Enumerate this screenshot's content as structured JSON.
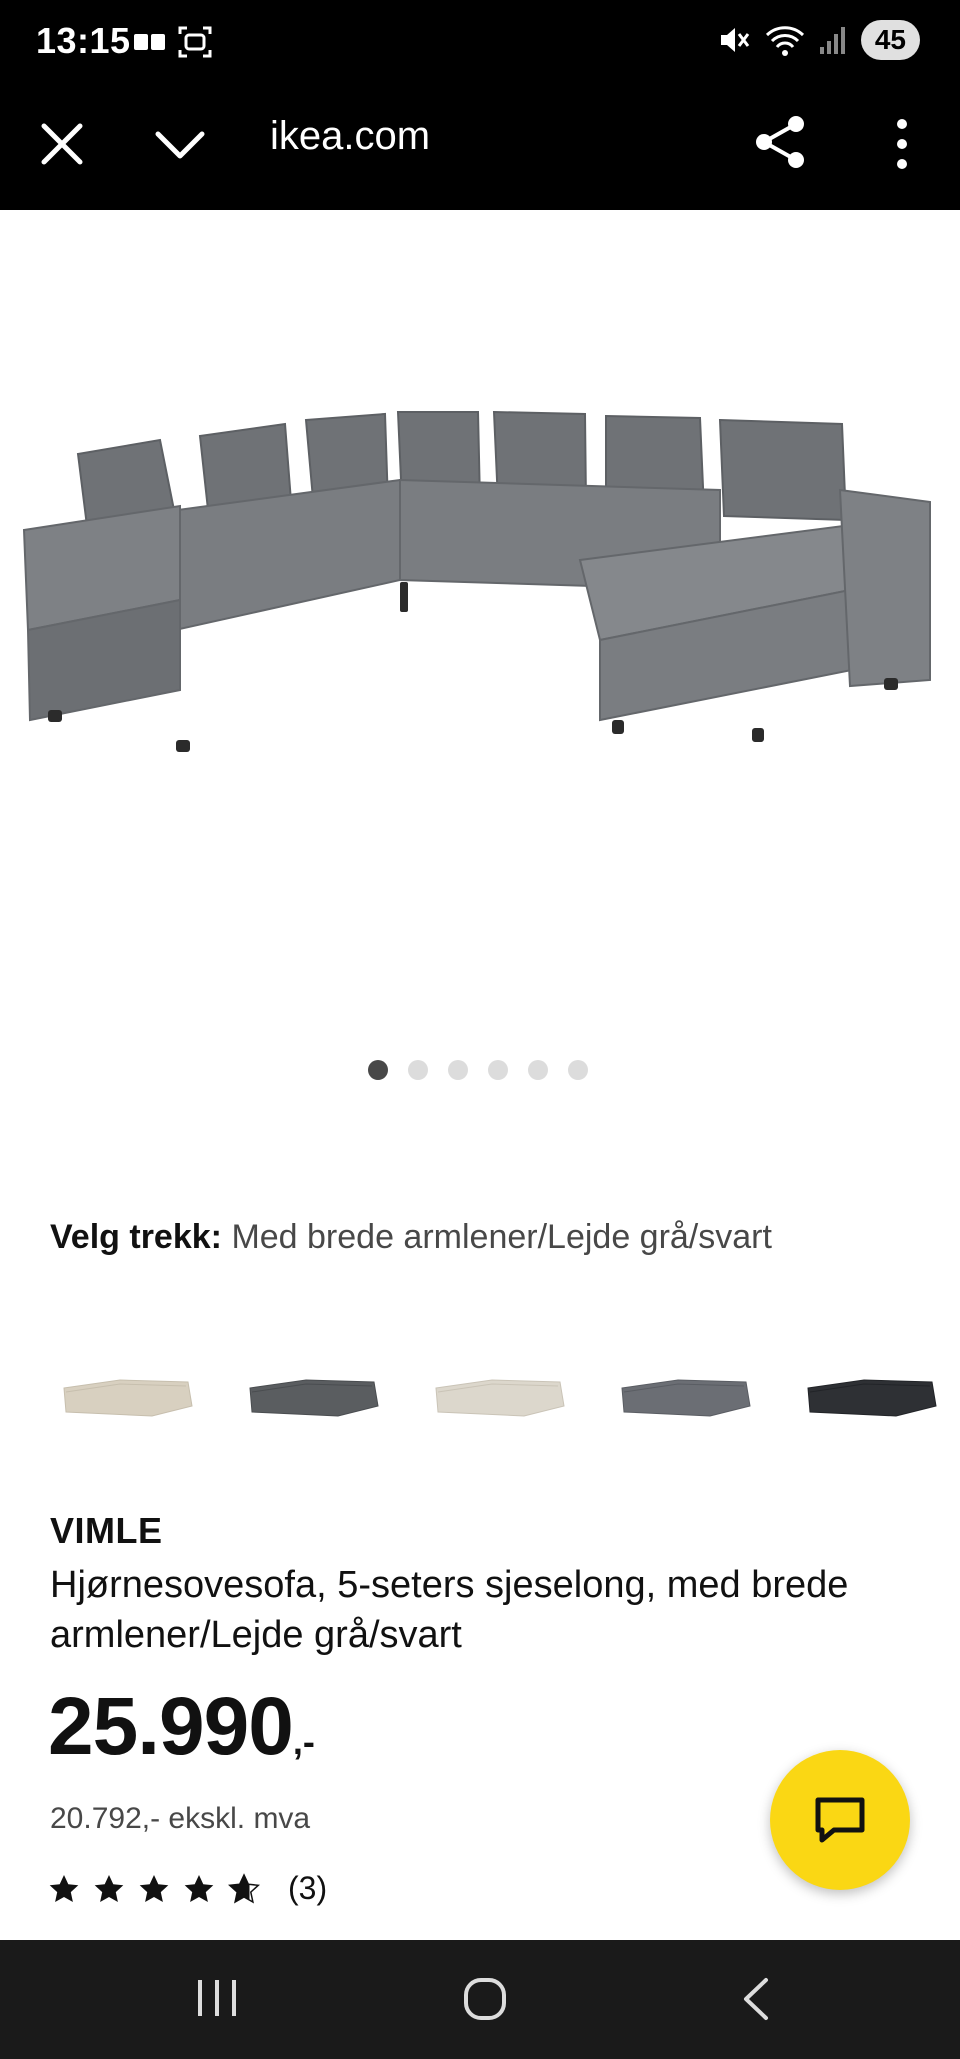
{
  "status_bar": {
    "time": "13:15",
    "battery": "45"
  },
  "browser": {
    "url": "ikea.com"
  },
  "carousel": {
    "dot_count": 6,
    "active_index": 0
  },
  "cover": {
    "label": "Velg trekk:",
    "value": "Med brede armlener/Lejde grå/svart"
  },
  "variants": [
    {
      "name": "variant-beige",
      "color": "#d8d0c0"
    },
    {
      "name": "variant-dark-grey",
      "color": "#5a5d60"
    },
    {
      "name": "variant-light-beige",
      "color": "#dcd7cc"
    },
    {
      "name": "variant-grey",
      "color": "#6b6e74"
    },
    {
      "name": "variant-black",
      "color": "#2e3034"
    }
  ],
  "product": {
    "brand": "VIMLE",
    "description": "Hjørnesovesofa, 5-seters sjeselong, med brede armlener/Lejde grå/svart",
    "price": "25.990",
    "price_suffix": ",-",
    "price_ex_vat": "20.792,- ekskl. mva",
    "rating_count": "(3)",
    "rating_value": 4.7
  },
  "colors": {
    "accent_yellow": "#fad714",
    "sofa_grey": "#75787b"
  }
}
